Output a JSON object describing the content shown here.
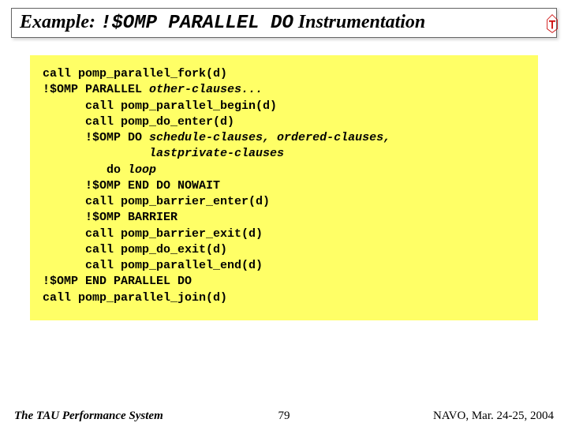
{
  "title": {
    "prefix": "Example:",
    "code": "!$OMP PARALLEL DO",
    "suffix": "Instrumentation"
  },
  "code": {
    "l01": "call pomp_parallel_fork(d)",
    "l02a": "!$OMP PARALLEL ",
    "l02b": "other-clauses...",
    "l03": "      call pomp_parallel_begin(d)",
    "l04": "      call pomp_do_enter(d)",
    "l05a": "      !$OMP DO ",
    "l05b": "schedule-clauses, ordered-clauses,",
    "l06a": "               ",
    "l06b": "lastprivate-clauses",
    "l07a": "         do ",
    "l07b": "loop",
    "l08": "      !$OMP END DO NOWAIT",
    "l09": "      call pomp_barrier_enter(d)",
    "l10": "      !$OMP BARRIER",
    "l11": "      call pomp_barrier_exit(d)",
    "l12": "      call pomp_do_exit(d)",
    "l13": "      call pomp_parallel_end(d)",
    "l14": "!$OMP END PARALLEL DO",
    "l15": "call pomp_parallel_join(d)"
  },
  "footer": {
    "left": "The TAU Performance System",
    "center": "79",
    "right": "NAVO, Mar. 24-25, 2004"
  }
}
